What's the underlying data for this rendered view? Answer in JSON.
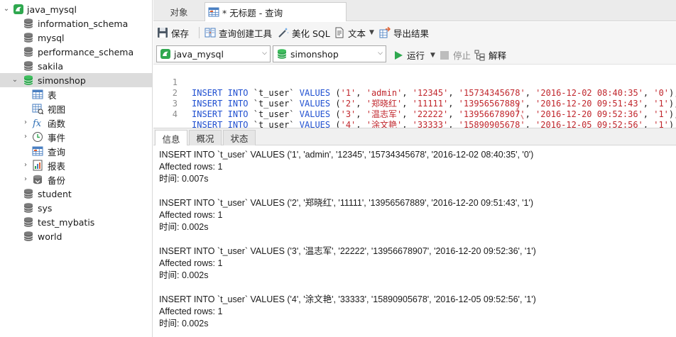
{
  "tree": {
    "items": [
      {
        "label": "java_mysql"
      },
      {
        "label": "information_schema"
      },
      {
        "label": "mysql"
      },
      {
        "label": "performance_schema"
      },
      {
        "label": "sakila"
      },
      {
        "label": "simonshop"
      },
      {
        "label": "表"
      },
      {
        "label": "视图"
      },
      {
        "label": "函数"
      },
      {
        "label": "事件"
      },
      {
        "label": "查询"
      },
      {
        "label": "报表"
      },
      {
        "label": "备份"
      },
      {
        "label": "student"
      },
      {
        "label": "sys"
      },
      {
        "label": "test_mybatis"
      },
      {
        "label": "world"
      }
    ]
  },
  "tabs": {
    "objects": "对象",
    "query": "* 无标题 - 查询"
  },
  "toolbar": {
    "save": "保存",
    "query_builder": "查询创建工具",
    "beautify": "美化 SQL",
    "text": "文本",
    "export": "导出结果"
  },
  "connbar": {
    "connection": "java_mysql",
    "database": "simonshop",
    "run": "运行",
    "stop": "停止",
    "explain": "解释"
  },
  "editor": {
    "lines": [
      {
        "no": "1",
        "tbl": "`t_user`",
        "v": [
          "'1'",
          "'admin'",
          "'12345'",
          "'15734345678'",
          "'2016-12-02 08:40:35'",
          "'0'"
        ]
      },
      {
        "no": "2",
        "tbl": "`t_user`",
        "v": [
          "'2'",
          "'郑晓红'",
          "'11111'",
          "'13956567889'",
          "'2016-12-20 09:51:43'",
          "'1'"
        ]
      },
      {
        "no": "3",
        "tbl": "`t_user`",
        "v": [
          "'3'",
          "'温志军'",
          "'22222'",
          "'13956678907'",
          "'2016-12-20 09:52:36'",
          "'1'"
        ]
      },
      {
        "no": "4",
        "tbl": "`t_user`",
        "v": [
          "'4'",
          "'涂文艳'",
          "'33333'",
          "'15890905678'",
          "'2016-12-05 09:52:56'",
          "'1'"
        ]
      }
    ],
    "kw_insert": "INSERT",
    "kw_into": "INTO",
    "kw_values": "VALUES"
  },
  "result_tabs": {
    "info": "信息",
    "profile": "概况",
    "status": "状态"
  },
  "messages": [
    {
      "sql": "INSERT INTO `t_user` VALUES ('1', 'admin', '12345', '15734345678', '2016-12-02 08:40:35', '0')",
      "affected": "Affected rows: 1",
      "time": "时间: 0.007s"
    },
    {
      "sql": "INSERT INTO `t_user` VALUES ('2', '郑晓红', '11111', '13956567889', '2016-12-20 09:51:43', '1')",
      "affected": "Affected rows: 1",
      "time": "时间: 0.002s"
    },
    {
      "sql": "INSERT INTO `t_user` VALUES ('3', '温志军', '22222', '13956678907', '2016-12-20 09:52:36', '1')",
      "affected": "Affected rows: 1",
      "time": "时间: 0.002s"
    },
    {
      "sql": "INSERT INTO `t_user` VALUES ('4', '涂文艳', '33333', '15890905678', '2016-12-05 09:52:56', '1')",
      "affected": "Affected rows: 1",
      "time": "时间: 0.002s"
    }
  ],
  "colors": {
    "keyword": "#1f4fd0",
    "string": "#c0262c",
    "db_green": "#2fa84f",
    "db_gray": "#6b6b6b",
    "selected_row": "#dcdcdc"
  },
  "icons": {
    "connection": "mysql-connection-icon",
    "database": "database-icon",
    "table": "table-icon",
    "view": "view-icon",
    "function": "function-icon",
    "event": "event-icon",
    "query": "query-icon",
    "report": "report-icon",
    "backup": "backup-icon"
  }
}
